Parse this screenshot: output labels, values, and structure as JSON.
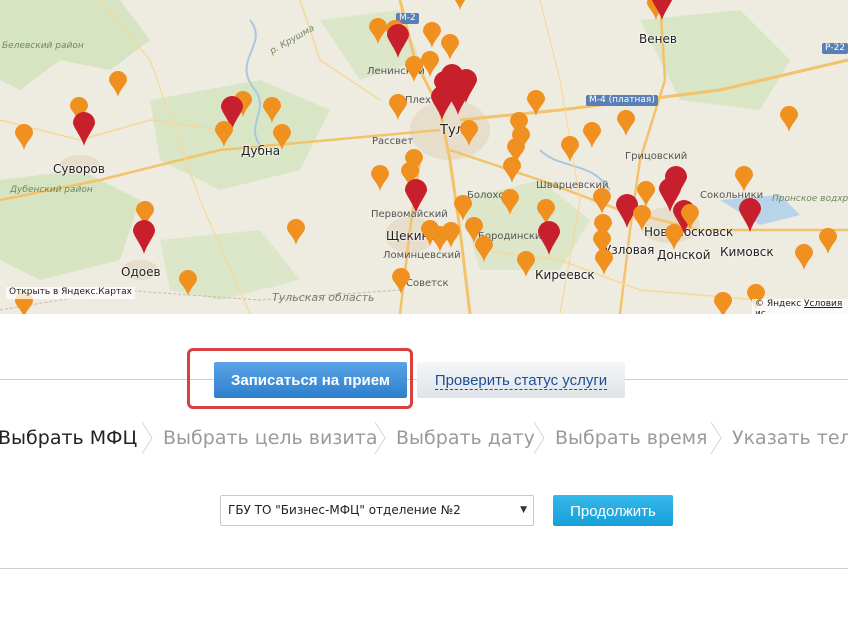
{
  "map": {
    "labels": {
      "kireevsk": "Киреевск",
      "venev": "Венев",
      "suvorov": "Суворов",
      "dubna": "Дубна",
      "tula": "Тула",
      "rassvet": "Рассвет",
      "lenin": "Ленинский",
      "plekh": "Плех",
      "boloh": "Болохово",
      "shvar": "Шварцевский",
      "grits": "Грицовский",
      "pervom": "Первомайский",
      "shchekino": "Щекино",
      "lomint": "Ломинцевский",
      "borodin": "Бородинский",
      "sovetsk": "Советск",
      "odoev": "Одоев",
      "uzlovaya": "Узловая",
      "donskoy": "Донской",
      "novomosk": "Новомосковск",
      "kimovsk": "Кимовск",
      "sokolniki": "Сокольники",
      "region": "Тульская область",
      "belev": "Белевский район",
      "dubenka": "Дубенский район",
      "krushma": "р. Крушма",
      "pronskoe": "Пронское водхр.",
      "hydro_m4": "М-4 (платная)",
      "m2": "М-2",
      "p22": "Р-22"
    },
    "open_in_yandex": "Открыть в Яндекс.Картах",
    "yandex_copyright": "© Яндекс",
    "terms_link": "Условия ис"
  },
  "actions": {
    "book_label": "Записаться на прием",
    "check_status_label": "Проверить статус услуги"
  },
  "steps": [
    {
      "label": "Выбрать МФЦ",
      "active": true
    },
    {
      "label": "Выбрать цель визита",
      "active": false
    },
    {
      "label": "Выбрать дату",
      "active": false
    },
    {
      "label": "Выбрать время",
      "active": false
    },
    {
      "label": "Указать теле",
      "active": false
    }
  ],
  "form": {
    "mfc_selected": "ГБУ ТО \"Бизнес-МФЦ\" отделение №2",
    "continue_label": "Продолжить"
  },
  "colors": {
    "pin_orange": "#f0901f",
    "pin_red": "#c81f2d",
    "primary_blue": "#2d7fcd",
    "continue_blue": "#1ea8e0",
    "highlight_red": "#d94040"
  }
}
